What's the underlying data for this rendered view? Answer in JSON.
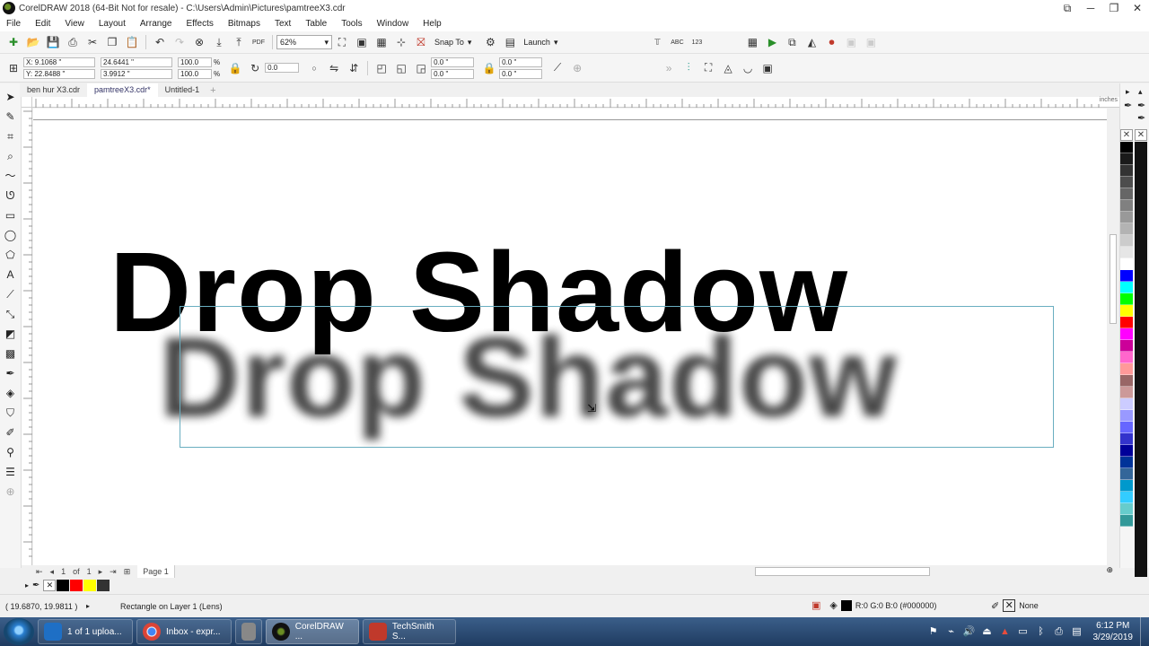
{
  "window": {
    "title": "CorelDRAW 2018 (64-Bit Not for resale) - C:\\Users\\Admin\\Pictures\\pamtreeX3.cdr",
    "minimize": "─",
    "maximize": "❐",
    "close": "✕"
  },
  "menu": [
    "File",
    "Edit",
    "View",
    "Layout",
    "Arrange",
    "Effects",
    "Bitmaps",
    "Text",
    "Table",
    "Tools",
    "Window",
    "Help"
  ],
  "toolbar": {
    "zoom": "62%",
    "snap_to": "Snap To",
    "launch": "Launch",
    "pdf_label": "PDF"
  },
  "propbar": {
    "x": "X: 9.1068 \"",
    "y": "Y: 22.8488 \"",
    "width": "24.6441 \"",
    "height": "3.9912 \"",
    "scale_w": "100.0",
    "scale_h": "100.0",
    "percent": "%",
    "rotation": "0.0",
    "corner1": "0.0 \"",
    "corner2": "0.0 \"",
    "corner3": "0.0 \"",
    "corner4": "0.0 \""
  },
  "tabs": [
    {
      "label": "ben hur X3.cdr"
    },
    {
      "label": "pamtreeX3.cdr*"
    },
    {
      "label": "Untitled-1"
    }
  ],
  "ruler_unit": "inches",
  "canvas": {
    "main_text": "Drop Shadow",
    "shadow_text": "Drop Shadow"
  },
  "pagenav": {
    "page_count": "1",
    "of_label": "of",
    "total": "1",
    "page_tab": "Page 1"
  },
  "status": {
    "coords": "( 19.6870, 19.9811 )",
    "object": "Rectangle on Layer 1  (Lens)",
    "fill": "R:0 G:0 B:0 (#000000)",
    "outline": "None"
  },
  "taskbar": {
    "tasks": [
      {
        "label": "1 of 1 uploa...",
        "color": "#1e6fc5"
      },
      {
        "label": "Inbox - expr...",
        "color": "#db4437"
      },
      {
        "label": "CorelDRAW ...",
        "color": "#6b8e23"
      },
      {
        "label": "TechSmith S...",
        "color": "#c0392b"
      }
    ],
    "time": "6:12 PM",
    "date": "3/29/2019"
  },
  "colors": {
    "lens_outline": "#6aaec0",
    "palette": [
      "#000000",
      "#1a1a1a",
      "#333333",
      "#4d4d4d",
      "#666666",
      "#808080",
      "#999999",
      "#b3b3b3",
      "#cccccc",
      "#e6e6e6",
      "#ffffff",
      "#0000ff",
      "#00ffff",
      "#00ff00",
      "#ffff00",
      "#ff0000",
      "#ff00ff",
      "#cc0099",
      "#ff66cc",
      "#ff9999",
      "#996666",
      "#cc9999",
      "#ccccff",
      "#9999ff",
      "#6666ff",
      "#3333cc",
      "#000099",
      "#003399",
      "#336699",
      "#0099cc",
      "#33ccff",
      "#66cccc",
      "#339999"
    ],
    "doc_palette": [
      "#000000",
      "#ff0000",
      "#ffff00",
      "#333333"
    ]
  }
}
